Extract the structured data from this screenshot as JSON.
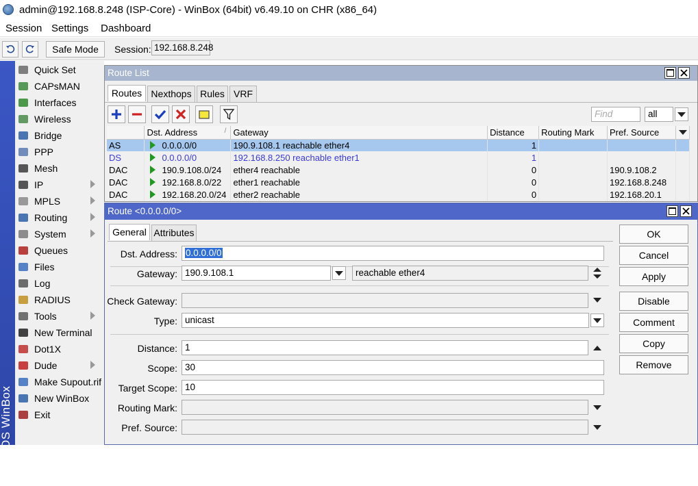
{
  "window": {
    "title": "admin@192.168.8.248 (ISP-Core) - WinBox (64bit) v6.49.10 on CHR (x86_64)"
  },
  "menubar": {
    "items": [
      "Session",
      "Settings",
      "Dashboard"
    ]
  },
  "toolbar": {
    "undo_icon": "undo-icon",
    "redo_icon": "redo-icon",
    "safe_mode": "Safe Mode",
    "session_label": "Session:",
    "session_value": "192.168.8.248"
  },
  "sidebar": {
    "brand": "RouterOS WinBox",
    "items": [
      {
        "label": "Quick Set",
        "icon": "wand-icon",
        "sub": false
      },
      {
        "label": "CAPsMAN",
        "icon": "antenna-icon",
        "sub": false
      },
      {
        "label": "Interfaces",
        "icon": "ethernet-icon",
        "sub": false
      },
      {
        "label": "Wireless",
        "icon": "wireless-icon",
        "sub": false
      },
      {
        "label": "Bridge",
        "icon": "bridge-icon",
        "sub": false
      },
      {
        "label": "PPP",
        "icon": "ppp-icon",
        "sub": false
      },
      {
        "label": "Mesh",
        "icon": "mesh-icon",
        "sub": false
      },
      {
        "label": "IP",
        "icon": "ip-icon",
        "sub": true
      },
      {
        "label": "MPLS",
        "icon": "mpls-icon",
        "sub": true
      },
      {
        "label": "Routing",
        "icon": "routing-icon",
        "sub": true
      },
      {
        "label": "System",
        "icon": "gear-icon",
        "sub": true
      },
      {
        "label": "Queues",
        "icon": "queue-icon",
        "sub": false
      },
      {
        "label": "Files",
        "icon": "folder-icon",
        "sub": false
      },
      {
        "label": "Log",
        "icon": "log-icon",
        "sub": false
      },
      {
        "label": "RADIUS",
        "icon": "users-icon",
        "sub": false
      },
      {
        "label": "Tools",
        "icon": "tools-icon",
        "sub": true
      },
      {
        "label": "New Terminal",
        "icon": "terminal-icon",
        "sub": false
      },
      {
        "label": "Dot1X",
        "icon": "dot1x-icon",
        "sub": false
      },
      {
        "label": "Dude",
        "icon": "dude-icon",
        "sub": true
      },
      {
        "label": "Make Supout.rif",
        "icon": "document-icon",
        "sub": false
      },
      {
        "label": "New WinBox",
        "icon": "winbox-icon",
        "sub": false
      },
      {
        "label": "Exit",
        "icon": "exit-icon",
        "sub": false
      }
    ]
  },
  "route_list": {
    "title": "Route List",
    "tabs": [
      "Routes",
      "Nexthops",
      "Rules",
      "VRF"
    ],
    "find_placeholder": "Find",
    "filter_value": "all",
    "columns": [
      "",
      "Dst. Address",
      "Gateway",
      "Distance",
      "Routing Mark",
      "Pref. Source"
    ],
    "rows": [
      {
        "flags": "AS",
        "dst": "0.0.0.0/0",
        "gateway": "190.9.108.1 reachable ether4",
        "distance": "1",
        "mark": "",
        "pref": "",
        "selected": true,
        "blue": false
      },
      {
        "flags": "DS",
        "dst": "0.0.0.0/0",
        "gateway": "192.168.8.250 reachable ether1",
        "distance": "1",
        "mark": "",
        "pref": "",
        "selected": false,
        "blue": true
      },
      {
        "flags": "DAC",
        "dst": "190.9.108.0/24",
        "gateway": "ether4 reachable",
        "distance": "0",
        "mark": "",
        "pref": "190.9.108.2",
        "selected": false,
        "blue": false
      },
      {
        "flags": "DAC",
        "dst": "192.168.8.0/22",
        "gateway": "ether1 reachable",
        "distance": "0",
        "mark": "",
        "pref": "192.168.8.248",
        "selected": false,
        "blue": false
      },
      {
        "flags": "DAC",
        "dst": "192.168.20.0/24",
        "gateway": "ether2 reachable",
        "distance": "0",
        "mark": "",
        "pref": "192.168.20.1",
        "selected": false,
        "blue": false
      }
    ]
  },
  "route_dialog": {
    "title": "Route <0.0.0.0/0>",
    "tabs": [
      "General",
      "Attributes"
    ],
    "labels": {
      "dst": "Dst. Address:",
      "gateway": "Gateway:",
      "check_gateway": "Check Gateway:",
      "type": "Type:",
      "distance": "Distance:",
      "scope": "Scope:",
      "target_scope": "Target Scope:",
      "routing_mark": "Routing Mark:",
      "pref_source": "Pref. Source:"
    },
    "values": {
      "dst": "0.0.0.0/0",
      "gateway": "190.9.108.1",
      "gateway_status": "reachable ether4",
      "check_gateway": "",
      "type": "unicast",
      "distance": "1",
      "scope": "30",
      "target_scope": "10",
      "routing_mark": "",
      "pref_source": ""
    },
    "buttons": [
      "OK",
      "Cancel",
      "Apply",
      "Disable",
      "Comment",
      "Copy",
      "Remove"
    ]
  }
}
